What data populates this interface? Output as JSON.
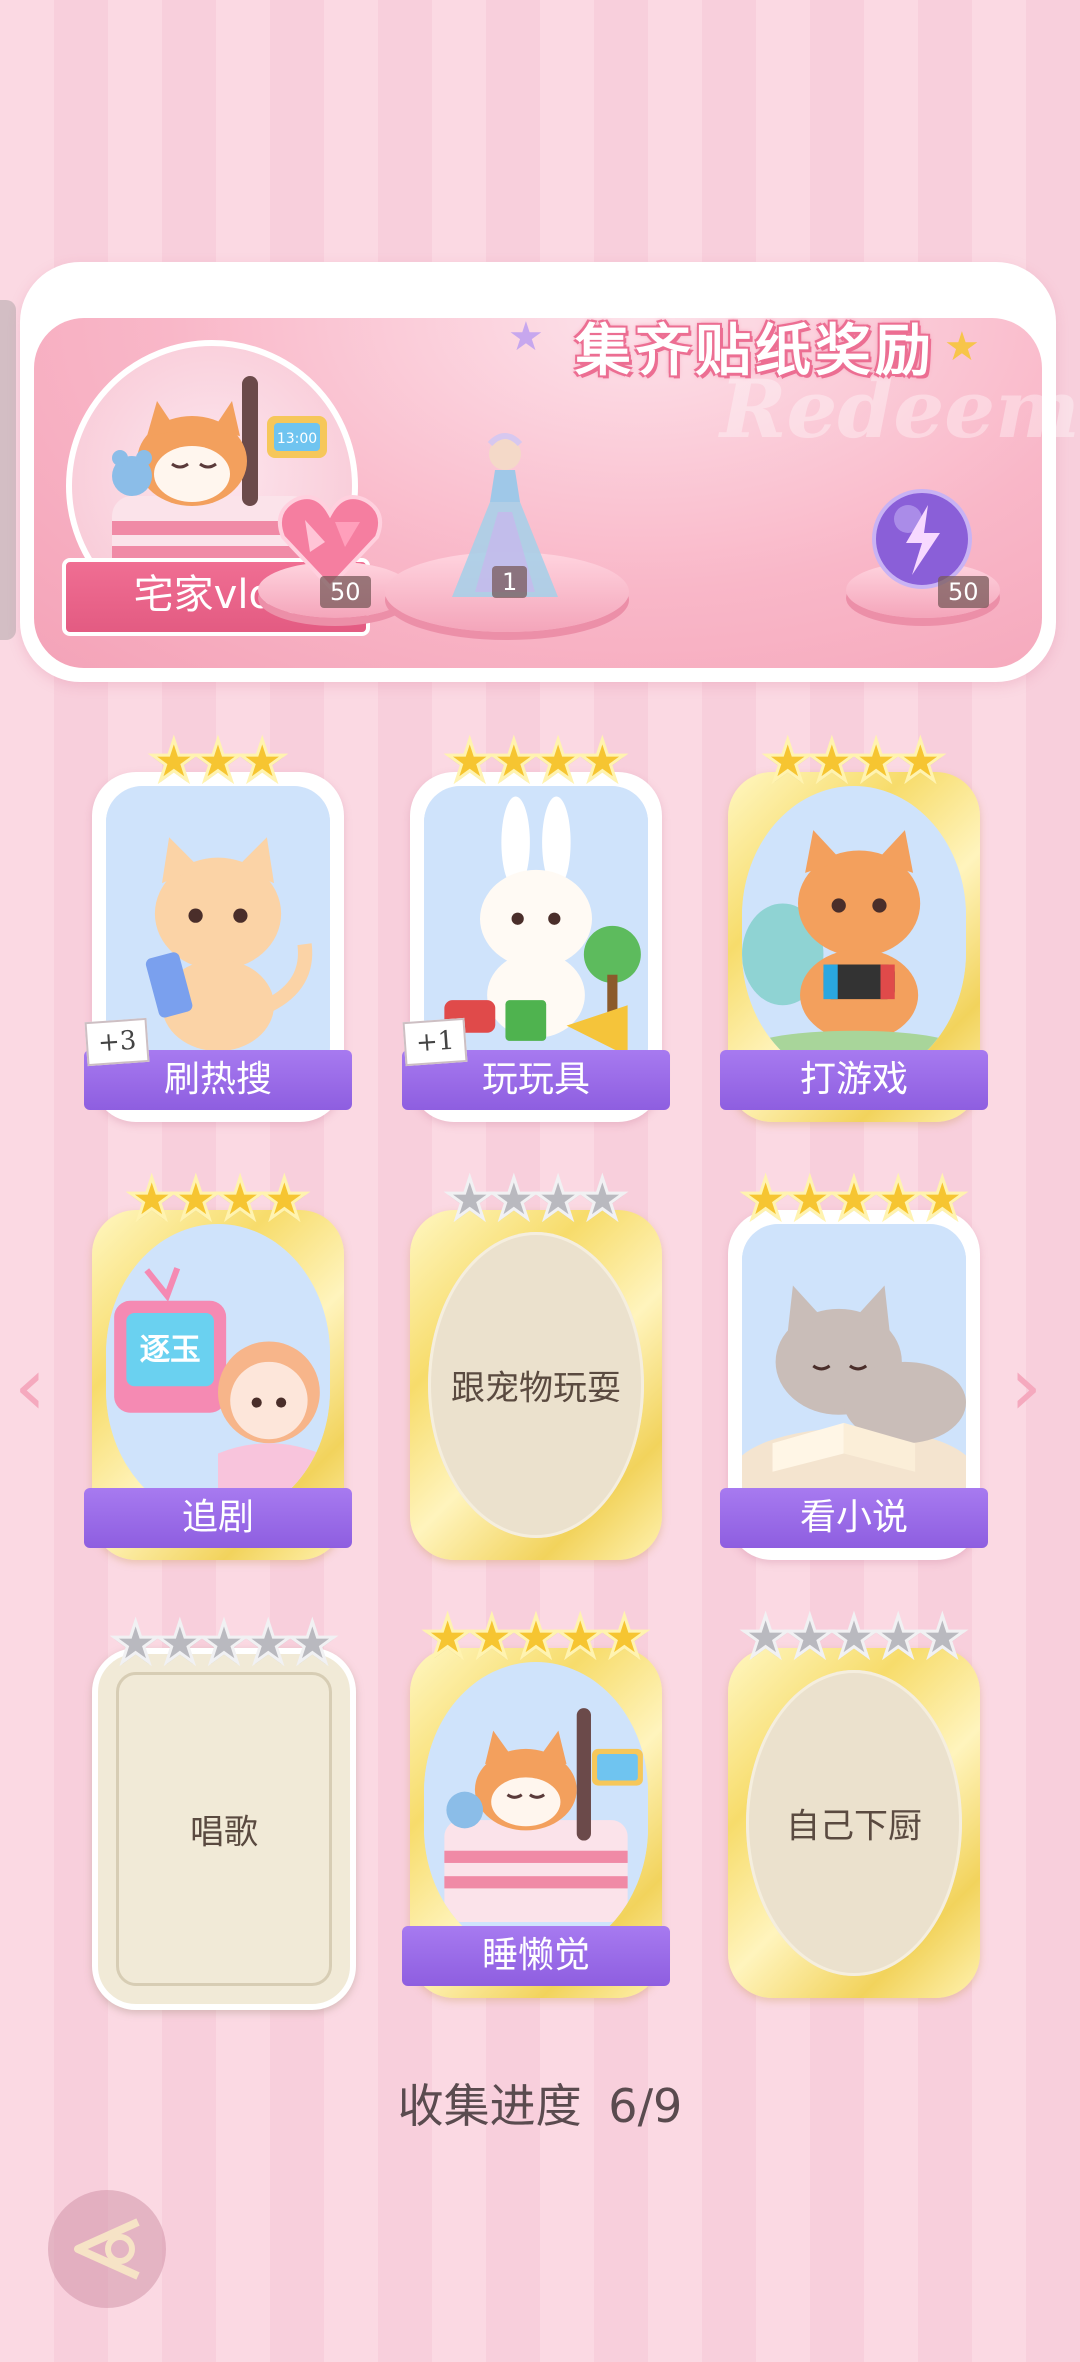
{
  "banner": {
    "title": "集齐贴纸奖励",
    "watermark": "Redeem",
    "theme_label": "宅家vlog",
    "rewards": [
      {
        "icon": "heart-gem-icon",
        "count": "50"
      },
      {
        "icon": "princess-dress-icon",
        "count": "1"
      },
      {
        "icon": "lightning-orb-icon",
        "count": "50"
      }
    ]
  },
  "cards": [
    {
      "label": "刷热搜",
      "stars": 3,
      "state": "collected",
      "badge": "+3",
      "art": "cat-phone"
    },
    {
      "label": "玩玩具",
      "stars": 4,
      "state": "collected",
      "badge": "+1",
      "art": "bunny-toys"
    },
    {
      "label": "打游戏",
      "stars": 4,
      "state": "collected",
      "badge": "",
      "art": "cat-game"
    },
    {
      "label": "追剧",
      "stars": 4,
      "state": "collected",
      "badge": "",
      "art": "girl-tv",
      "tv_text": "逐玉"
    },
    {
      "label": "跟宠物玩耍",
      "stars": 4,
      "state": "locked",
      "badge": "",
      "art": ""
    },
    {
      "label": "看小说",
      "stars": 5,
      "state": "collected",
      "badge": "",
      "art": "cat-book"
    },
    {
      "label": "唱歌",
      "stars": 5,
      "state": "locked",
      "badge": "",
      "art": ""
    },
    {
      "label": "睡懒觉",
      "stars": 5,
      "state": "collected",
      "badge": "",
      "art": "dog-bed"
    },
    {
      "label": "自己下厨",
      "stars": 5,
      "state": "locked",
      "badge": "",
      "art": ""
    }
  ],
  "progress": {
    "label": "收集进度",
    "value": "6/9"
  },
  "colors": {
    "ribbon": "#9b6ae8",
    "star_gold": "#f6c531",
    "star_silver": "#b9b9bf",
    "banner_pink": "#f4a3b8"
  }
}
